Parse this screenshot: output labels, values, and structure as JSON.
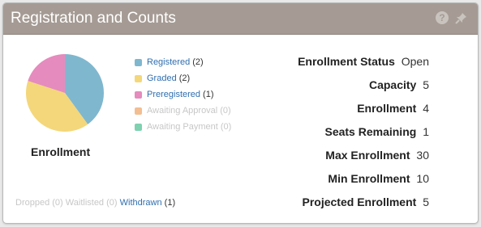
{
  "panel": {
    "title": "Registration and Counts",
    "help_icon_glyph": "?"
  },
  "chart_data": {
    "type": "pie",
    "label": "Enrollment",
    "slices": [
      {
        "name": "Registered",
        "value": 2,
        "color": "#7fb7cf"
      },
      {
        "name": "Graded",
        "value": 2,
        "color": "#f4d77a"
      },
      {
        "name": "Preregistered",
        "value": 1,
        "color": "#e58bbd"
      }
    ]
  },
  "legend": [
    {
      "label": "Registered",
      "count": "(2)",
      "color": "#7fb7cf",
      "enabled": true
    },
    {
      "label": "Graded",
      "count": "(2)",
      "color": "#f4d77a",
      "enabled": true
    },
    {
      "label": "Preregistered",
      "count": "(1)",
      "color": "#e58bbd",
      "enabled": true
    },
    {
      "label": "Awaiting Approval",
      "count": "(0)",
      "color": "#f3be92",
      "enabled": false
    },
    {
      "label": "Awaiting Payment",
      "count": "(0)",
      "color": "#7fd1b0",
      "enabled": false
    }
  ],
  "bottom": {
    "dropped_label": "Dropped",
    "dropped_count": "(0)",
    "waitlisted_label": "Waitlisted",
    "waitlisted_count": "(0)",
    "withdrawn_label": "Withdrawn",
    "withdrawn_count": "(1)"
  },
  "stats": [
    {
      "label": "Enrollment Status",
      "value": "Open"
    },
    {
      "label": "Capacity",
      "value": "5"
    },
    {
      "label": "Enrollment",
      "value": "4"
    },
    {
      "label": "Seats Remaining",
      "value": "1"
    },
    {
      "label": "Max Enrollment",
      "value": "30"
    },
    {
      "label": "Min Enrollment",
      "value": "10"
    },
    {
      "label": "Projected Enrollment",
      "value": "5"
    }
  ]
}
